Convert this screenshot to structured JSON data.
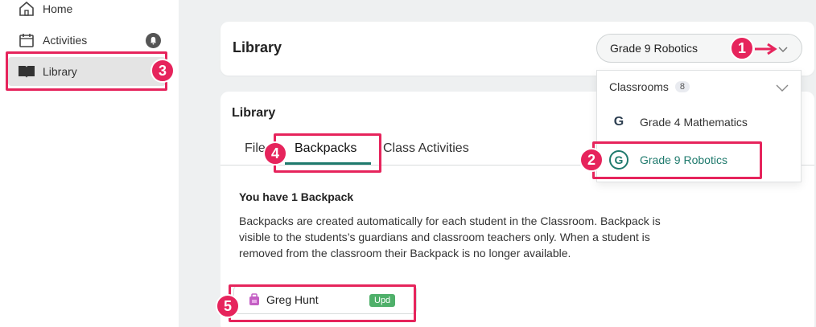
{
  "sidebar": {
    "items": [
      {
        "label": "Home",
        "icon": "home-icon"
      },
      {
        "label": "Activities",
        "icon": "calendar-icon"
      },
      {
        "label": "Library",
        "icon": "book-icon"
      }
    ]
  },
  "header": {
    "title": "Library",
    "classroom_select": "Grade 9 Robotics"
  },
  "library": {
    "title": "Library",
    "tabs": [
      "Files",
      "Backpacks",
      "Class Activities"
    ],
    "active_tab": "Backpacks",
    "heading": "You have 1 Backpack",
    "description": "Backpacks are created automatically for each student in the Classroom. Backpack is visible to the students’s guardians and classroom teachers only. When a student is removed from the classroom their Backpack is no longer available.",
    "backpacks": [
      {
        "name": "Greg Hunt",
        "badge": "Upd"
      }
    ]
  },
  "dropdown": {
    "header": "Classrooms",
    "count": "8",
    "items": [
      {
        "label": "Grade 4 Mathematics",
        "logo": "G"
      },
      {
        "label": "Grade 9 Robotics",
        "logo": "G"
      }
    ],
    "selected": "Grade 9 Robotics"
  },
  "annotations": [
    "1",
    "2",
    "3",
    "4",
    "5"
  ],
  "colors": {
    "accent": "#1f7a6d",
    "highlight": "#e6245c",
    "badge": "#4fb06a",
    "background": "#eef0f1"
  }
}
